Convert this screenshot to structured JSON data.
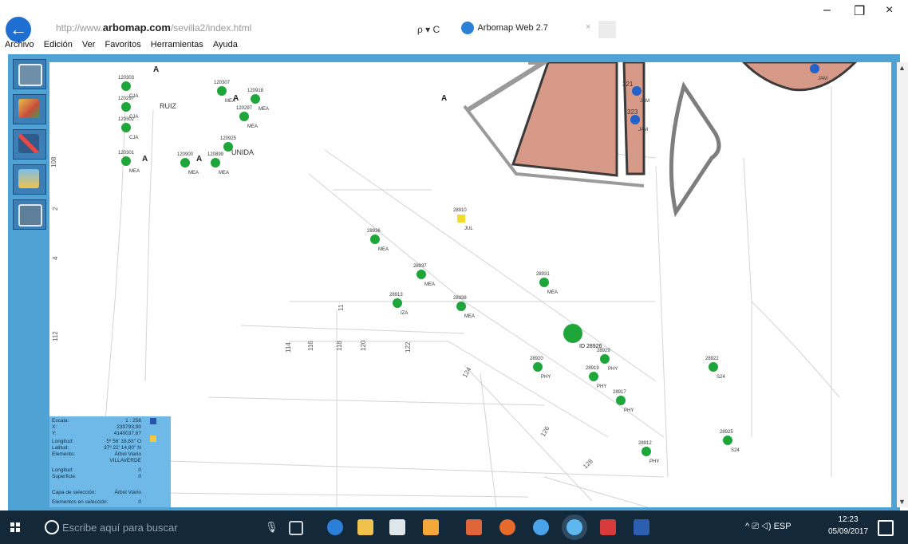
{
  "browser": {
    "back_icon": "back-arrow-icon",
    "url_prefix": "http://www.",
    "url_domain": "arbomap.com",
    "url_path": "/sevilla2/index.html",
    "search_controls": "ρ ▾ C",
    "tab_title": "Arbomap Web 2.7",
    "tab_close": "×",
    "window_minimize": "–",
    "window_restore": "❐",
    "window_close": "×",
    "menu": [
      "Archivo",
      "Edición",
      "Ver",
      "Favoritos",
      "Herramientas",
      "Ayuda"
    ]
  },
  "colors": {
    "frame_blue": "#4ea2d4",
    "tree_green": "#1fa63a",
    "tree_blue": "#2362c9",
    "tree_yellow": "#f2dd2f",
    "building_fill": "#d79a89",
    "building_stroke": "#3a3a3a",
    "taskbar": "#13293a",
    "panel_blue": "#6eb9e8"
  },
  "map": {
    "trees": [
      {
        "id": "120303",
        "species": "CJA",
        "color": "green"
      },
      {
        "id": "120297",
        "species": "CJA",
        "color": "green"
      },
      {
        "id": "120302",
        "species": "CJA",
        "color": "green"
      },
      {
        "id": "120301",
        "species": "MEA",
        "color": "green"
      },
      {
        "id": "120307",
        "species": "MEA",
        "color": "green"
      },
      {
        "id": "120918",
        "species": "MEA",
        "color": "green"
      },
      {
        "id": "120297",
        "species": "MEA",
        "color": "green"
      },
      {
        "id": "120925",
        "species": "",
        "color": "green"
      },
      {
        "id": "120900",
        "species": "MEA",
        "color": "green"
      },
      {
        "id": "120899",
        "species": "MEA",
        "color": "green"
      },
      {
        "id": "321",
        "species": "JAM",
        "color": "blue"
      },
      {
        "id": "323",
        "species": "JAM",
        "color": "blue"
      },
      {
        "id": "",
        "species": "JAM",
        "color": "blue"
      },
      {
        "id": "28910",
        "species": "JUL",
        "color": "yellow"
      },
      {
        "id": "28936",
        "species": "MEA",
        "color": "green"
      },
      {
        "id": "28937",
        "species": "MEA",
        "color": "green"
      },
      {
        "id": "28931",
        "species": "MEA",
        "color": "green"
      },
      {
        "id": "28913",
        "species": "IZA",
        "color": "green"
      },
      {
        "id": "28938",
        "species": "MEA",
        "color": "green"
      },
      {
        "id": "",
        "species": "",
        "color": "green"
      },
      {
        "id": "28920",
        "species": "PHY",
        "color": "green"
      },
      {
        "id": "28929",
        "species": "PHY",
        "color": "green"
      },
      {
        "id": "28919",
        "species": "PHY",
        "color": "green"
      },
      {
        "id": "28917",
        "species": "PHY",
        "color": "green"
      },
      {
        "id": "28922",
        "species": "S24",
        "color": "green"
      },
      {
        "id": "28925",
        "species": "S24",
        "color": "green"
      },
      {
        "id": "28912",
        "species": "PHY",
        "color": "green"
      }
    ],
    "selection_label": "ID 28926",
    "letter_markers": [
      "A",
      "A",
      "A",
      "A",
      "A"
    ],
    "street_labels": [
      "RUIZ",
      "UNIDA"
    ],
    "address_numbers": [
      "108",
      "2",
      "4",
      "112",
      "114",
      "116",
      "118",
      "120",
      "122",
      "124",
      "126",
      "128",
      "11"
    ]
  },
  "info_panel": {
    "rows": [
      {
        "label": "Escala:",
        "value": "1 : 256"
      },
      {
        "label": "X:",
        "value": "239793,90"
      },
      {
        "label": "Y:",
        "value": "4140037,67"
      },
      {
        "label": "Longitud:",
        "value": "5º 56' 18,83'' O"
      },
      {
        "label": "Latitud:",
        "value": "37º 22' 14,80'' N"
      },
      {
        "label": "Elemento:",
        "value": "Árbol Viario"
      },
      {
        "label": "",
        "value": "VILLAVERDE"
      },
      {
        "label": "Longitud:",
        "value": "0"
      },
      {
        "label": "Superficie:",
        "value": "0"
      },
      {
        "label": "Capa de selección:",
        "value": "Árbol Viario"
      },
      {
        "label": "Elementos en selección:",
        "value": "0"
      }
    ]
  },
  "toolbar_tools": [
    "layers-icon",
    "map-tools-icon",
    "edit-tools-icon",
    "users-icon",
    "print-icon"
  ],
  "taskbar": {
    "search_placeholder": "Escribe aquí para buscar",
    "mic_icon": "microphone-icon",
    "apps": [
      "task-view-icon",
      "edge-icon",
      "explorer-icon",
      "store-icon",
      "photos-icon",
      "media-icon",
      "firefox-icon",
      "ie-icon",
      "ie-active-icon",
      "acrobat-icon",
      "word-icon"
    ],
    "tray_text": "^ ⎚ ◁) ESP",
    "time": "12:23",
    "date": "05/09/2017"
  }
}
